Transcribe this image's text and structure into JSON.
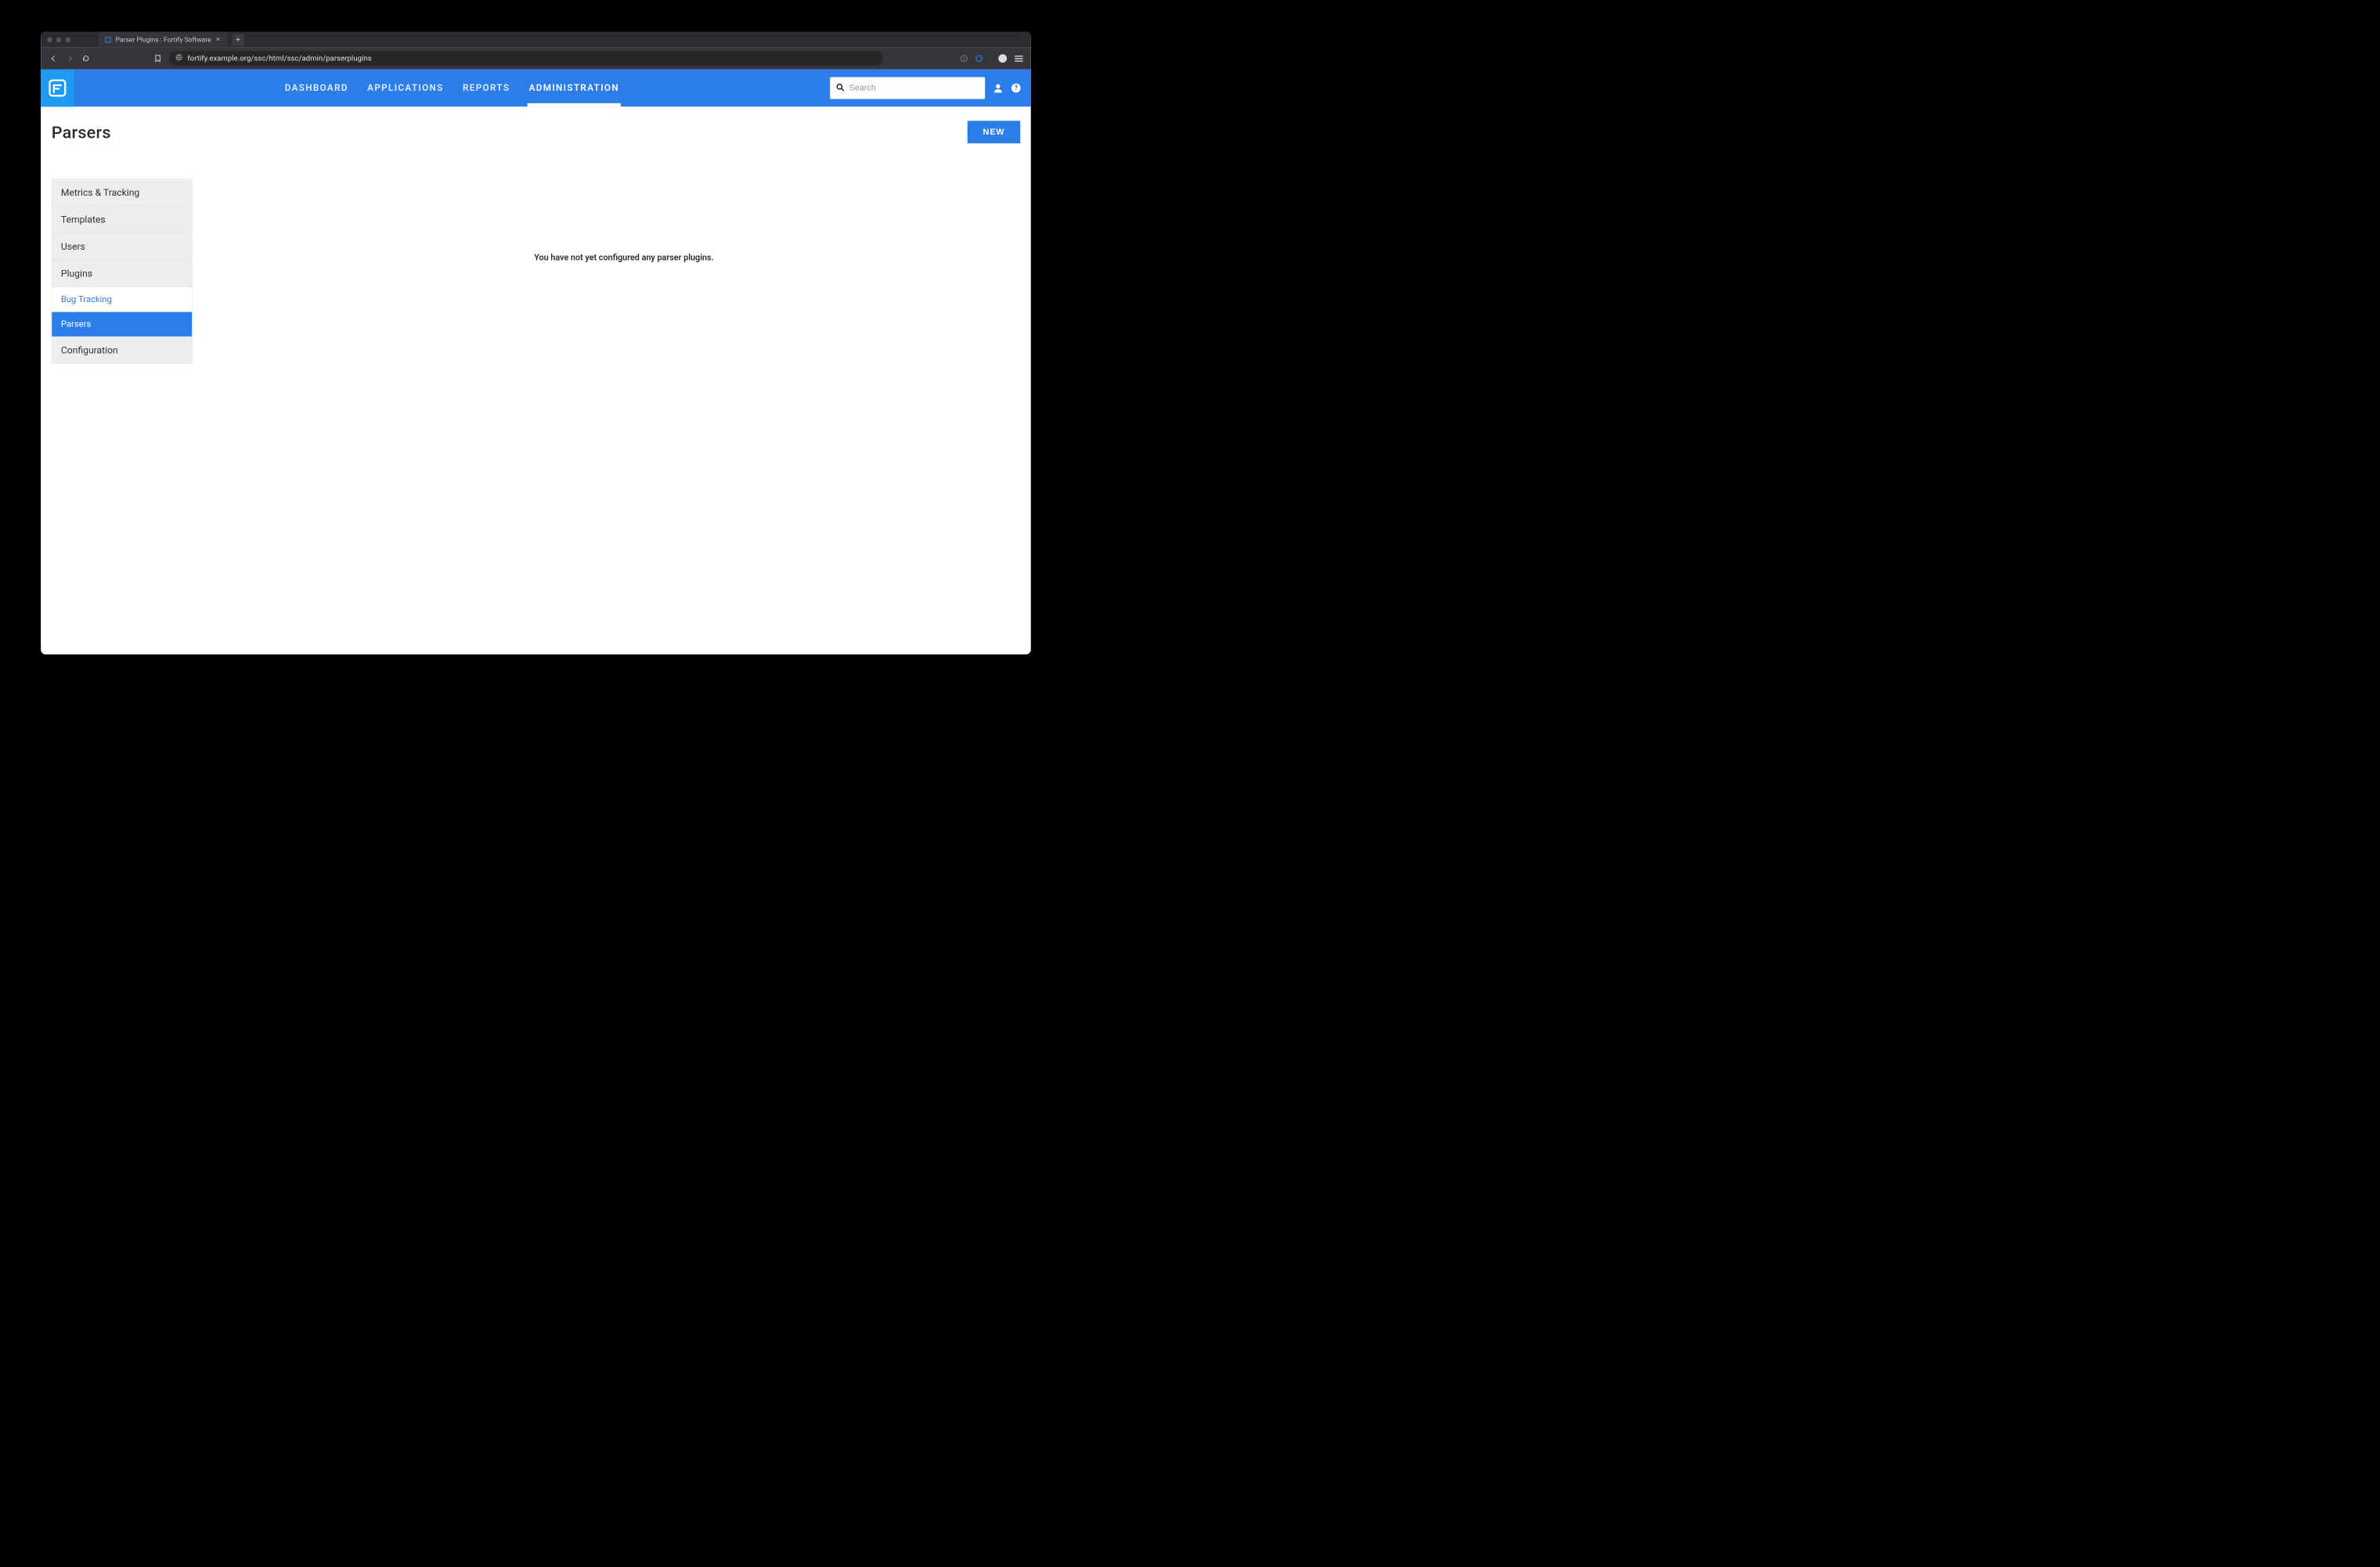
{
  "browser": {
    "tab_title": "Parser Plugins : Fortify Software",
    "url": "fortify.example.org/ssc/html/ssc/admin/parserplugins"
  },
  "header": {
    "nav": {
      "dashboard": "DASHBOARD",
      "applications": "APPLICATIONS",
      "reports": "REPORTS",
      "administration": "ADMINISTRATION"
    },
    "search_placeholder": "Search"
  },
  "page": {
    "title": "Parsers",
    "new_button": "NEW",
    "empty_message": "You have not yet configured any parser plugins."
  },
  "sidebar": {
    "items": [
      {
        "label": "Metrics & Tracking"
      },
      {
        "label": "Templates"
      },
      {
        "label": "Users"
      },
      {
        "label": "Plugins"
      }
    ],
    "sub": {
      "bug_tracking": "Bug Tracking",
      "parsers": "Parsers"
    },
    "config": "Configuration"
  }
}
